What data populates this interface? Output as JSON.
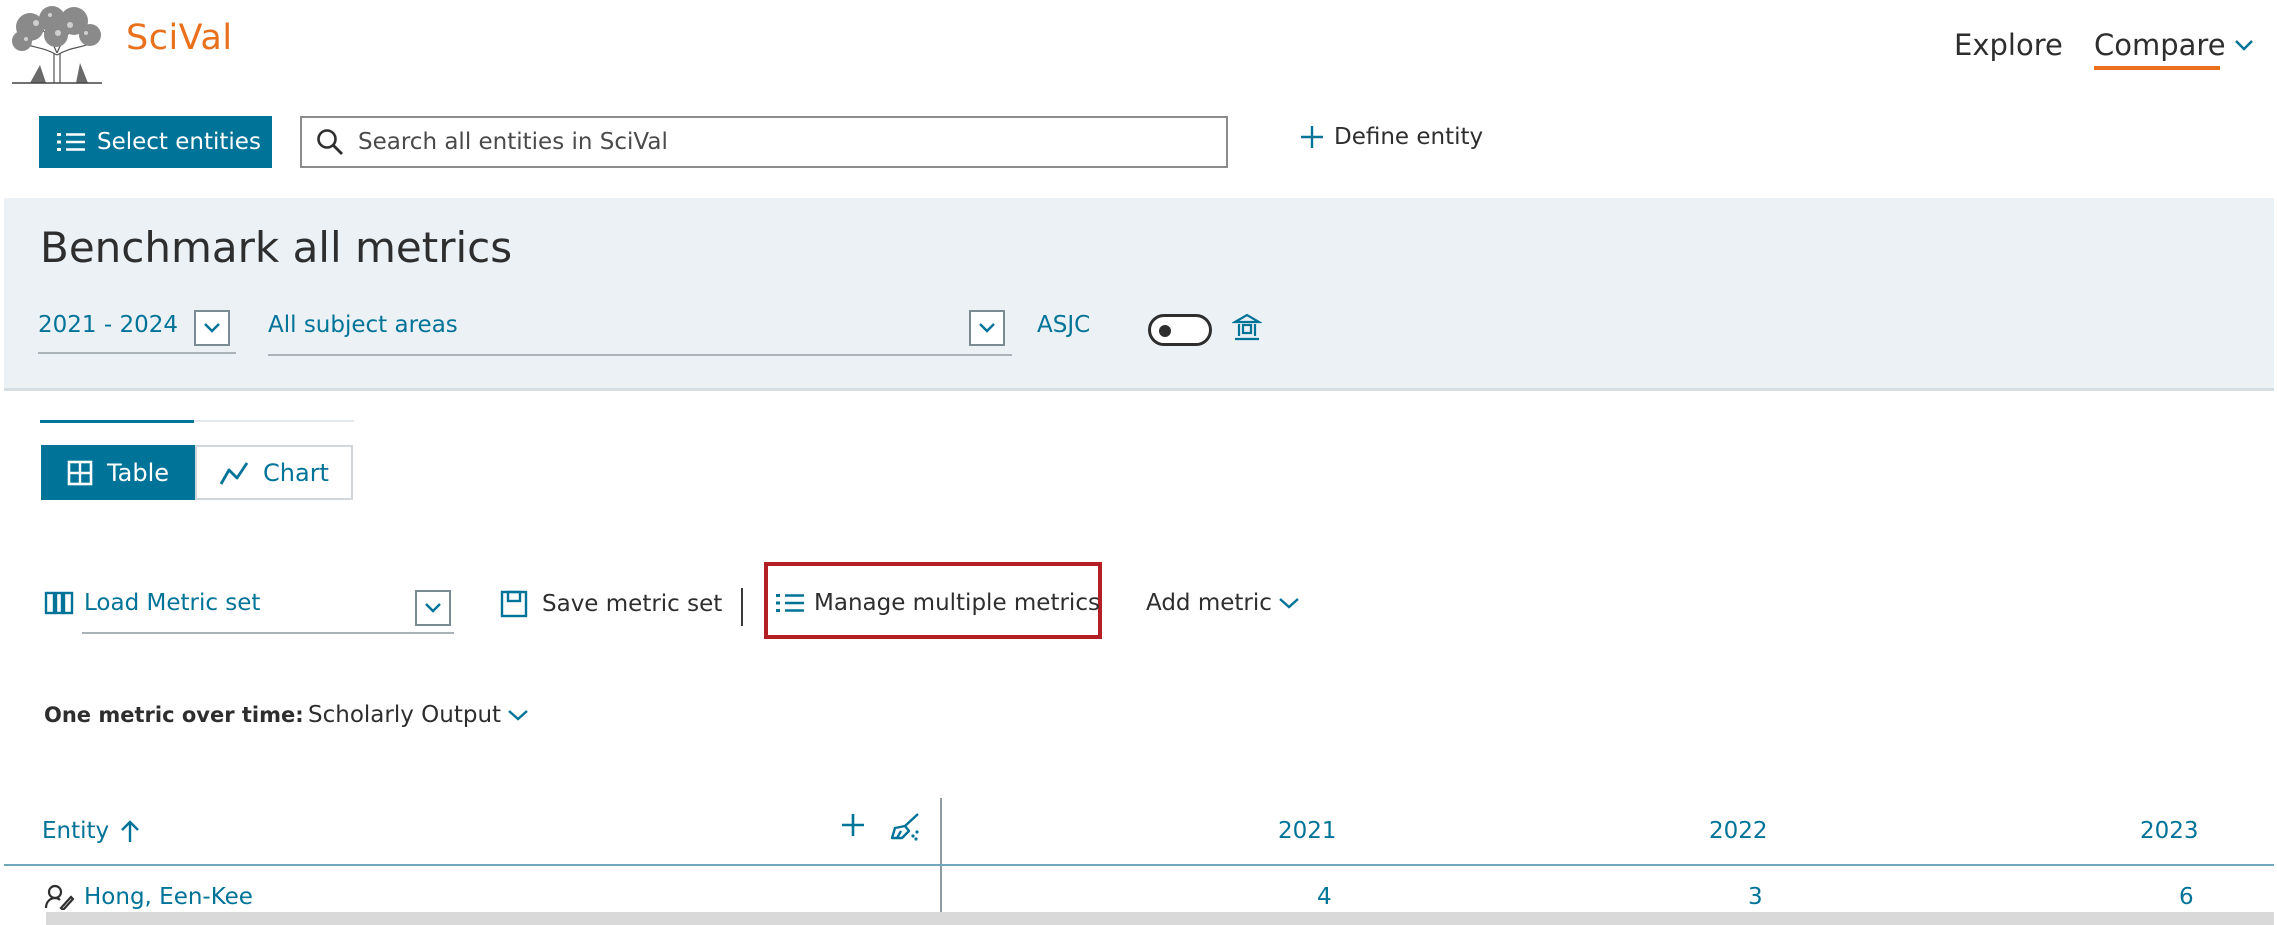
{
  "header": {
    "brand": "SciVal",
    "nav": {
      "explore": "Explore",
      "compare": "Compare"
    }
  },
  "search_row": {
    "select_entities": "Select entities",
    "search_placeholder": "Search all entities in SciVal",
    "define_entity": "Define entity"
  },
  "benchmark": {
    "title": "Benchmark all metrics",
    "year_range": "2021 - 2024",
    "subject_area": "All subject areas",
    "classification": "ASJC",
    "toggle_on": false
  },
  "view_tabs": {
    "table": "Table",
    "chart": "Chart",
    "active": "table"
  },
  "metric_toolbar": {
    "load_metric_set": "Load Metric set",
    "save_metric_set": "Save metric set",
    "manage_multiple_metrics": "Manage multiple metrics",
    "add_metric": "Add metric"
  },
  "one_metric": {
    "label": "One metric over time:",
    "value": "Scholarly Output"
  },
  "table": {
    "entity_header": "Entity",
    "years": [
      "2021",
      "2022",
      "2023"
    ],
    "rows": [
      {
        "entity": "Hong, Een-Kee",
        "values": [
          "4",
          "3",
          "6"
        ]
      }
    ]
  },
  "colors": {
    "brand_orange": "#e9711c",
    "accent_teal": "#007398",
    "highlight_red": "#b21f24"
  }
}
